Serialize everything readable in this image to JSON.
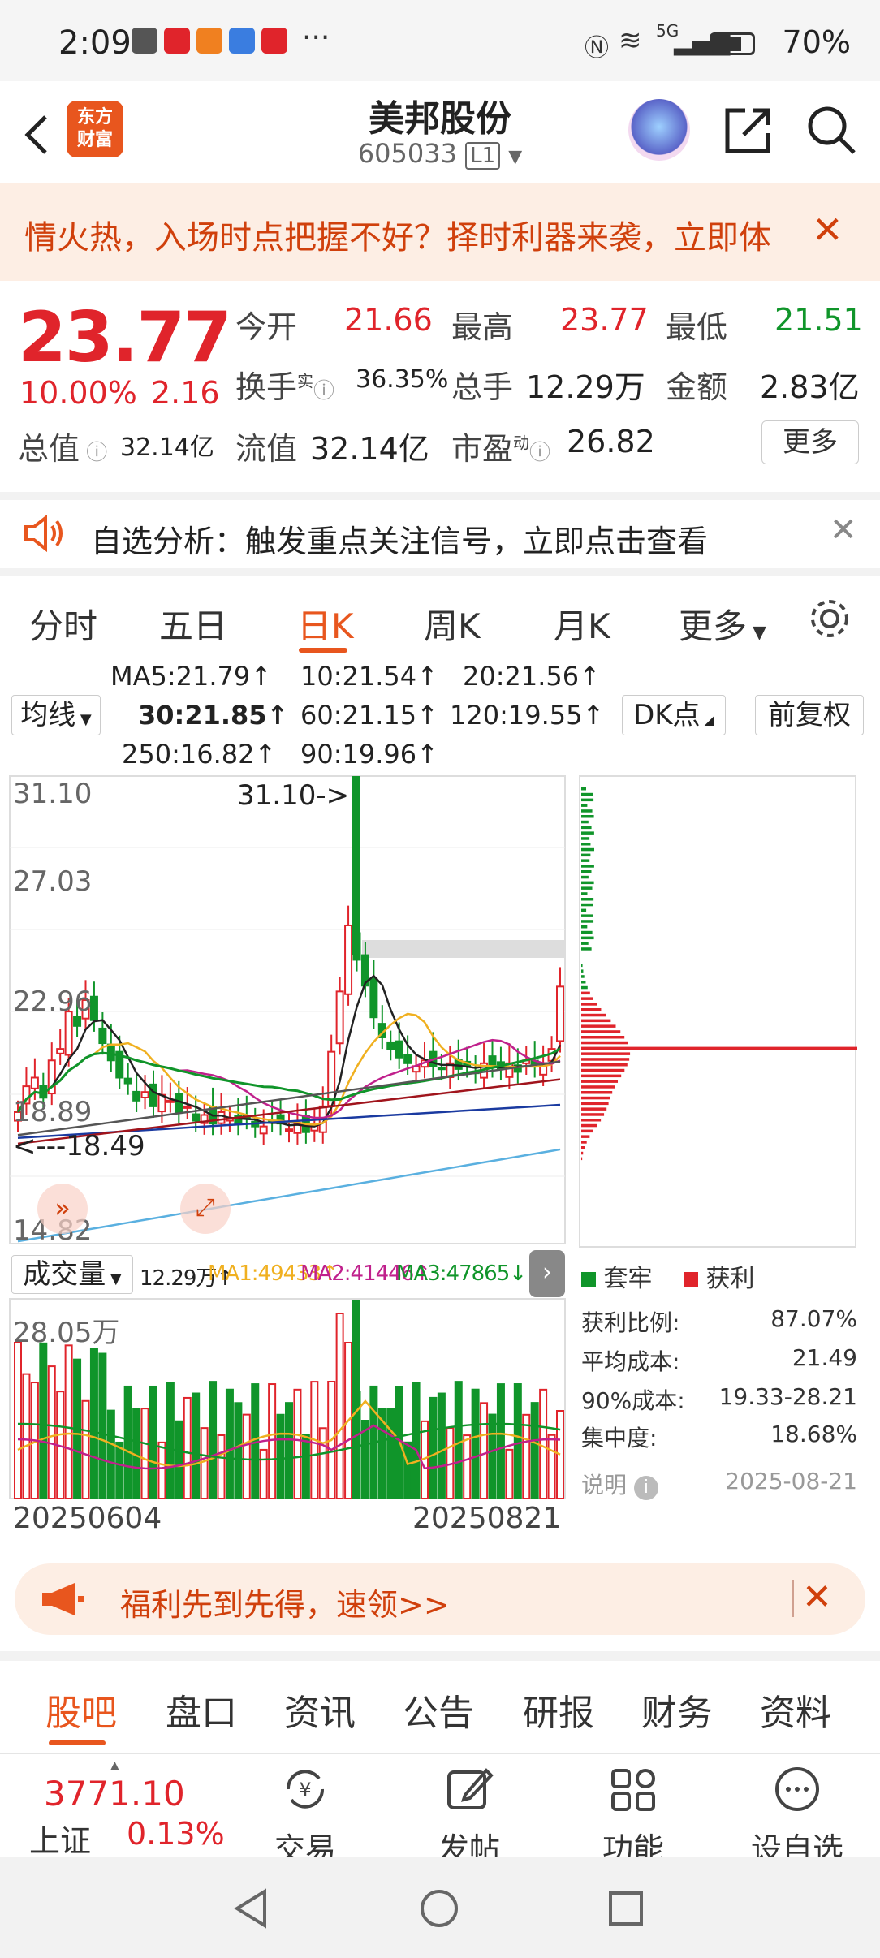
{
  "status_bar": {
    "time": "2:09",
    "battery": "70%",
    "network": "5G"
  },
  "header": {
    "title": "美邦股份",
    "code": "605033",
    "level": "L1",
    "logo_line1": "东方",
    "logo_line2": "财富"
  },
  "ad_banner": {
    "text": "情火热，入场时点把握不好？择时利器来袭，立即体"
  },
  "quote": {
    "price": "23.77",
    "pct": "10.00%",
    "change": "2.16",
    "open_label": "今开",
    "open": "21.66",
    "high_label": "最高",
    "high": "23.77",
    "low_label": "最低",
    "low": "21.51",
    "turnover_label": "换手",
    "turnover_sup": "实",
    "turnover": "36.35%",
    "volume_label": "总手",
    "volume": "12.29万",
    "amount_label": "金额",
    "amount": "2.83亿",
    "mktcap_label": "总值",
    "mktcap": "32.14亿",
    "float_label": "流值",
    "float": "32.14亿",
    "pe_label": "市盈",
    "pe_sup": "动",
    "pe": "26.82",
    "more": "更多"
  },
  "alert": {
    "text": "自选分析：触发重点关注信号，立即点击查看"
  },
  "chart_tabs": [
    {
      "label": "分时"
    },
    {
      "label": "五日"
    },
    {
      "label": "日K"
    },
    {
      "label": "周K"
    },
    {
      "label": "月K"
    },
    {
      "label": "更多"
    }
  ],
  "ma_legend": {
    "selector": "均线",
    "ma5": "MA5:21.79↑",
    "ma10": "10:21.54↑",
    "ma20": "20:21.56↑",
    "ma30": "30:21.85↑",
    "ma60": "60:21.15↑",
    "ma120": "120:19.55↑",
    "ma250": "250:16.82↑",
    "ma90": "90:19.96↑",
    "dk": "DK点",
    "adjust": "前复权",
    "colors": {
      "ma5": "#222222",
      "ma10": "#f0b020",
      "ma20": "#c0208c",
      "ma30": "#10952a",
      "ma60": "#555555",
      "ma120": "#1a3aa0",
      "ma250": "#5ab0e0",
      "ma90": "#a0141c"
    }
  },
  "price_axis": {
    "top": "31.10",
    "l2": "27.03",
    "l3": "22.96",
    "l4": "18.89",
    "bottom": "14.82",
    "max_marker": "31.10->",
    "min_marker": "<---18.49"
  },
  "volume_legend": {
    "selector": "成交量",
    "vol": "12.29万↑",
    "ma1": "MA1:49433↑",
    "ma2": "MA2:41446↑",
    "ma3": "MA3:47865↓",
    "axis_max": "28.05万"
  },
  "dates": {
    "start": "20250604",
    "end": "20250821"
  },
  "chip": {
    "legend_trapped": "套牢",
    "legend_profit": "获利",
    "rows": [
      {
        "label": "获利比例:",
        "value": "87.07%"
      },
      {
        "label": "平均成本:",
        "value": "21.49"
      },
      {
        "label": "90%成本:",
        "value": "19.33-28.21"
      },
      {
        "label": "集中度:",
        "value": "18.68%"
      }
    ],
    "note": "说明",
    "date": "2025-08-21"
  },
  "welfare": {
    "text": "福利先到先得，速领>>"
  },
  "bottom_tabs": [
    {
      "label": "股吧"
    },
    {
      "label": "盘口"
    },
    {
      "label": "资讯"
    },
    {
      "label": "公告"
    },
    {
      "label": "研报"
    },
    {
      "label": "财务"
    },
    {
      "label": "资料"
    }
  ],
  "index": {
    "value": "3771.10",
    "name": "上证",
    "pct": "0.13%"
  },
  "bottom_bar": [
    {
      "label": "交易"
    },
    {
      "label": "发帖"
    },
    {
      "label": "功能"
    },
    {
      "label": "设自选"
    }
  ]
}
